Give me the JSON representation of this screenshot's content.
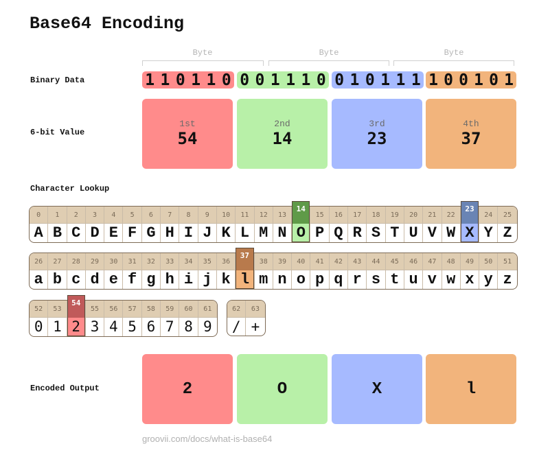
{
  "title": "Base64 Encoding",
  "labels": {
    "binary": "Binary Data",
    "sixbit": "6-bit Value",
    "lookup": "Character Lookup",
    "output": "Encoded Output"
  },
  "bytes": [
    "Byte",
    "Byte",
    "Byte"
  ],
  "colors": {
    "red": "#ff8b8b",
    "green": "#b8f0a8",
    "blue": "#a6baff",
    "orange": "#f2b47c",
    "red_dark": "#c05a5a",
    "green_dark": "#5f9a48",
    "blue_dark": "#6a84b4",
    "orange_dark": "#b87a4c",
    "lookup_header": "#dfcdb2"
  },
  "groups": [
    {
      "bits": [
        "1",
        "1",
        "0",
        "1",
        "1",
        "0"
      ],
      "ordinal": "1st",
      "value": "54",
      "char": "2"
    },
    {
      "bits": [
        "0",
        "0",
        "1",
        "1",
        "1",
        "0"
      ],
      "ordinal": "2nd",
      "value": "14",
      "char": "O"
    },
    {
      "bits": [
        "0",
        "1",
        "0",
        "1",
        "1",
        "1"
      ],
      "ordinal": "3rd",
      "value": "23",
      "char": "X"
    },
    {
      "bits": [
        "1",
        "0",
        "0",
        "1",
        "0",
        "1"
      ],
      "ordinal": "4th",
      "value": "37",
      "char": "l"
    }
  ],
  "lookup": {
    "upper": [
      "A",
      "B",
      "C",
      "D",
      "E",
      "F",
      "G",
      "H",
      "I",
      "J",
      "K",
      "L",
      "M",
      "N",
      "O",
      "P",
      "Q",
      "R",
      "S",
      "T",
      "U",
      "V",
      "W",
      "X",
      "Y",
      "Z"
    ],
    "lower": [
      "a",
      "b",
      "c",
      "d",
      "e",
      "f",
      "g",
      "h",
      "i",
      "j",
      "k",
      "l",
      "m",
      "n",
      "o",
      "p",
      "q",
      "r",
      "s",
      "t",
      "u",
      "v",
      "w",
      "x",
      "y",
      "z"
    ],
    "digits": [
      "0",
      "1",
      "2",
      "3",
      "4",
      "5",
      "6",
      "7",
      "8",
      "9"
    ],
    "symbols": [
      "/",
      "+"
    ],
    "highlights": {
      "14": "green",
      "23": "blue",
      "37": "orange",
      "54": "red"
    }
  },
  "footer": "groovii.com/docs/what-is-base64"
}
